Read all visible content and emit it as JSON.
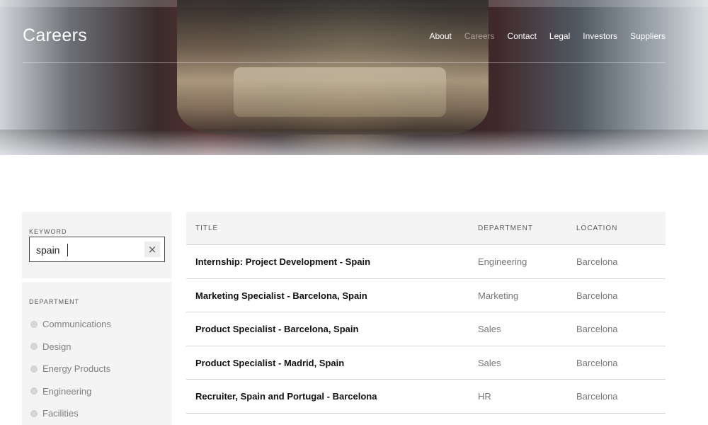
{
  "header": {
    "brand": "Careers",
    "nav": [
      {
        "label": "About",
        "active": false
      },
      {
        "label": "Careers",
        "active": true
      },
      {
        "label": "Contact",
        "active": false
      },
      {
        "label": "Legal",
        "active": false
      },
      {
        "label": "Investors",
        "active": false
      },
      {
        "label": "Suppliers",
        "active": false
      }
    ]
  },
  "filters": {
    "keyword_label": "KEYWORD",
    "keyword_value": "spain",
    "clear_icon": "×",
    "department_label": "DEPARTMENT",
    "departments": [
      "Communications",
      "Design",
      "Energy Products",
      "Engineering",
      "Facilities"
    ]
  },
  "table": {
    "columns": [
      "TITLE",
      "DEPARTMENT",
      "LOCATION"
    ],
    "rows": [
      {
        "title": "Internship: Project Development - Spain",
        "department": "Engineering",
        "location": "Barcelona"
      },
      {
        "title": "Marketing Specialist - Barcelona, Spain",
        "department": "Marketing",
        "location": "Barcelona"
      },
      {
        "title": "Product Specialist - Barcelona, Spain",
        "department": "Sales",
        "location": "Barcelona"
      },
      {
        "title": "Product Specialist - Madrid, Spain",
        "department": "Sales",
        "location": "Barcelona"
      },
      {
        "title": "Recruiter, Spain and Portugal - Barcelona",
        "department": "HR",
        "location": "Barcelona"
      }
    ]
  },
  "colors": {
    "panel_bg": "#f4f4f4",
    "row_border": "#d6d6d6",
    "text_dark": "#111111",
    "text_muted": "#777777"
  }
}
